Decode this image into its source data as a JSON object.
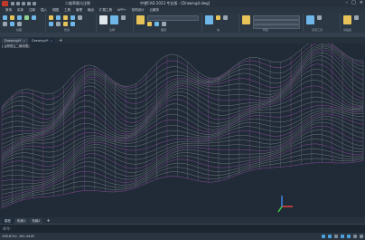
{
  "titlebar": {
    "app_title": "中望CAD 2023 专业版 - [Drawing4.dwg]",
    "quick_open": "二维草图与注释"
  },
  "menubar": {
    "items": [
      "常用",
      "实体",
      "注释",
      "插入",
      "视图",
      "工具",
      "管理",
      "输出",
      "扩展工具",
      "APP+",
      "协同设计",
      "云服务"
    ]
  },
  "ribbon": {
    "groups": [
      "绘图",
      "修改",
      "注释",
      "图层",
      "块",
      "特性",
      "实用工具",
      "剪贴板"
    ],
    "layer_name": "图层特性",
    "bylayer": "ByLayer"
  },
  "tabs": [
    {
      "label": "Drawing4*",
      "active": false
    },
    {
      "label": "Drawing4*",
      "active": true
    }
  ],
  "viewport": {
    "view_label": "[-][俯视][二维线框]"
  },
  "bottom_tabs": [
    {
      "label": "模型",
      "active": true
    },
    {
      "label": "布局1",
      "active": false
    },
    {
      "label": "布局2",
      "active": false
    },
    {
      "label": "+",
      "active": false
    }
  ],
  "cmdline": {
    "prompt": "命令:",
    "placeholder": ""
  },
  "statusbar": {
    "coordinates": "298.6742, 161.4418"
  },
  "colors": {
    "mesh_gray": "#9aa0a6",
    "mesh_magenta": "#c55ad1",
    "ucs_x": "#e0413a",
    "ucs_y": "#3ec94a",
    "ucs_z": "#3a7fe0"
  }
}
